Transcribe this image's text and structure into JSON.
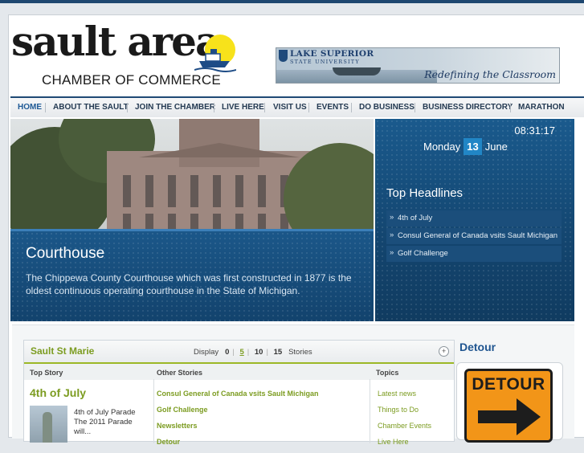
{
  "header": {
    "logo_word": "sault area",
    "logo_sub": "CHAMBER OF COMMERCE",
    "ad": {
      "title": "LAKE SUPERIOR",
      "subtitle": "STATE UNIVERSITY",
      "tagline": "Redefining the Classroom"
    }
  },
  "nav": {
    "items": [
      "HOME",
      "ABOUT THE SAULT",
      "JOIN THE CHAMBER",
      "LIVE HERE",
      "VISIT US",
      "EVENTS",
      "DO BUSINESS",
      "BUSINESS DIRECTORY",
      "MARATHON"
    ]
  },
  "hero": {
    "title": "Courthouse",
    "text": "The Chippewa County Courthouse which was first constructed in 1877 is the oldest continuous operating courthouse in the State of Michigan."
  },
  "panel": {
    "clock": "08:31:17",
    "weekday": "Monday",
    "day": "13",
    "month": "June",
    "headlines_title": "Top Headlines",
    "headlines": [
      "4th of July",
      "Consul General of Canada vsits Sault Michigan",
      "Golf Challenge"
    ]
  },
  "news_box": {
    "title": "Sault St Marie",
    "display_label": "Display",
    "display_options": [
      "0",
      "5",
      "10",
      "15"
    ],
    "display_selected": "5",
    "stories_label": "Stories",
    "col_top": "Top Story",
    "col_other": "Other Stories",
    "col_topics": "Topics",
    "top_story_title": "4th of July",
    "top_story_text": "4th of July Parade The 2011 Parade will...",
    "other_stories": [
      "Consul General of Canada vsits Sault Michigan",
      "Golf Challenge",
      "Newsletters",
      "Detour"
    ],
    "topics": [
      "Latest news",
      "Things to Do",
      "Chamber Events",
      "Live Here"
    ]
  },
  "detour": {
    "title": "Detour",
    "sign_text": "DETOUR"
  },
  "colors": {
    "navy": "#1f4a75",
    "accent_green": "#7c9c21",
    "sign_orange": "#f29518"
  }
}
